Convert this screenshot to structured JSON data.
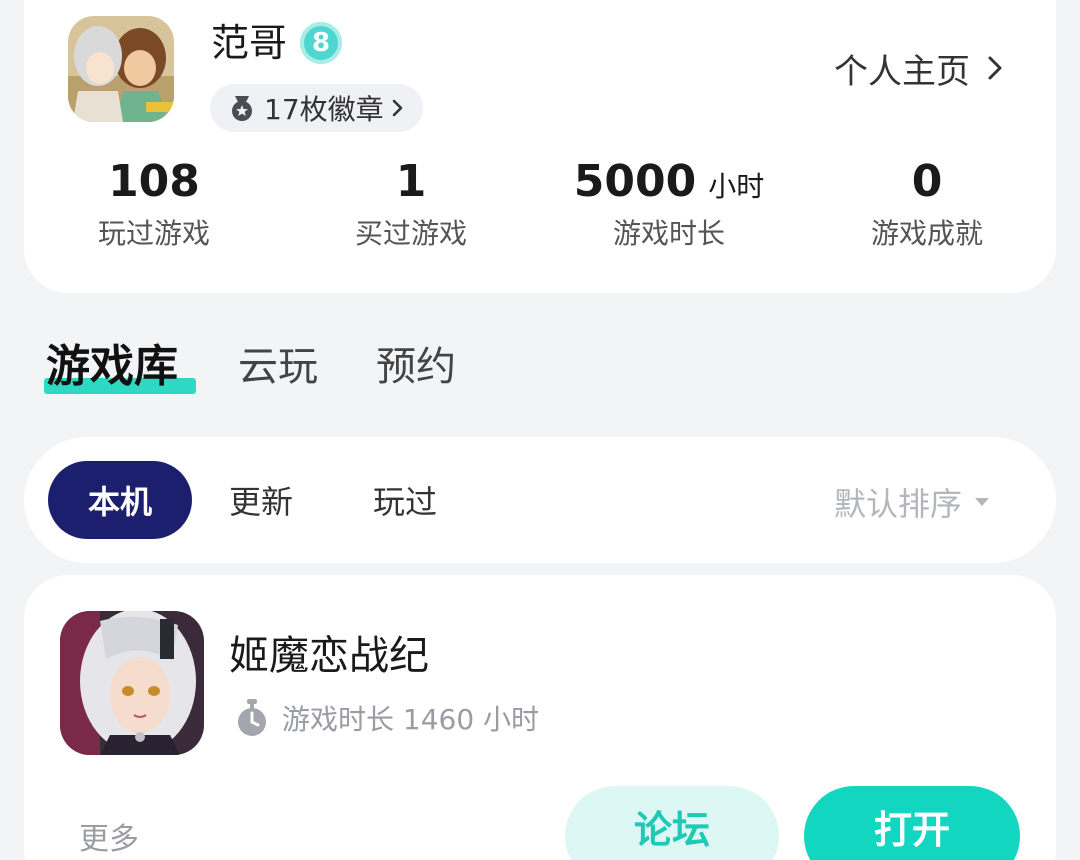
{
  "colors": {
    "accent": "#13d6c0",
    "accent_soft": "#ddf7f4",
    "chip_active": "#1c1f6e",
    "underline": "#2ed9c4"
  },
  "profile": {
    "name": "范哥",
    "level": "8",
    "badges_label": "17枚徽章",
    "homepage_label": "个人主页",
    "avatar_icon": "user-avatar-image"
  },
  "stats": [
    {
      "value": "108",
      "unit": "",
      "label": "玩过游戏"
    },
    {
      "value": "1",
      "unit": "",
      "label": "买过游戏"
    },
    {
      "value": "5000",
      "unit": "小时",
      "label": "游戏时长"
    },
    {
      "value": "0",
      "unit": "",
      "label": "游戏成就"
    }
  ],
  "tabs": [
    "游戏库",
    "云玩",
    "预约"
  ],
  "filters": {
    "chips": [
      "本机",
      "更新",
      "玩过"
    ],
    "sort_label": "默认排序"
  },
  "game": {
    "title": "姬魔恋战纪",
    "playtime": "游戏时长 1460 小时",
    "more_label": "更多",
    "forum_label": "论坛",
    "open_label": "打开",
    "icon": "game-cover-image"
  }
}
